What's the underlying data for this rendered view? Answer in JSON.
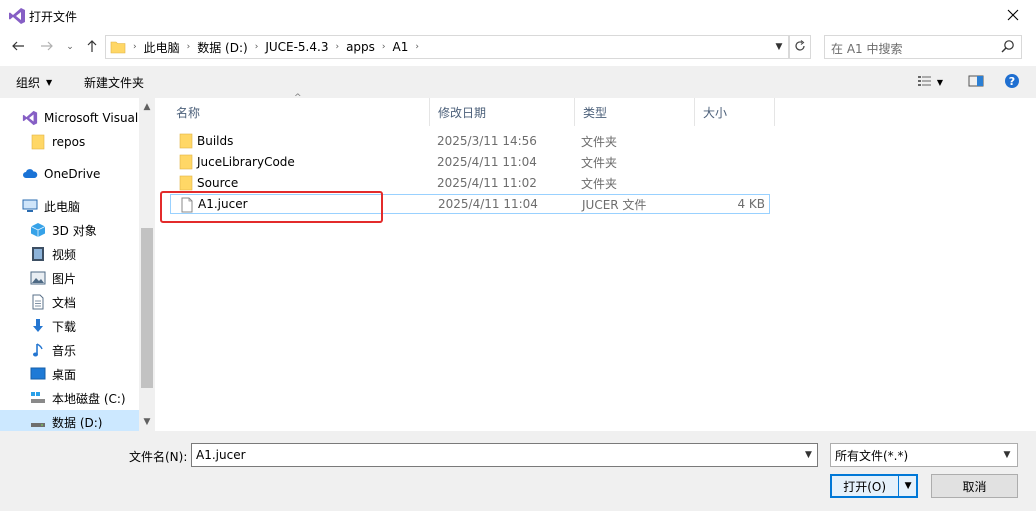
{
  "window": {
    "title": "打开文件",
    "app_icon": "visual-studio-icon",
    "close_icon": "close-icon"
  },
  "address": {
    "crumbs": [
      "此电脑",
      "数据 (D:)",
      "JUCE-5.4.3",
      "apps",
      "A1"
    ],
    "search_placeholder": "在 A1 中搜索"
  },
  "toolbar": {
    "organize_label": "组织",
    "new_folder_label": "新建文件夹"
  },
  "sidebar": {
    "items": [
      {
        "label": "Microsoft Visual",
        "icon": "visual-studio-icon"
      },
      {
        "label": "repos",
        "icon": "folder-icon"
      },
      {
        "label": "OneDrive",
        "icon": "cloud-icon"
      },
      {
        "label": "此电脑",
        "icon": "computer-icon"
      },
      {
        "label": "3D 对象",
        "icon": "cube-icon"
      },
      {
        "label": "视频",
        "icon": "video-icon"
      },
      {
        "label": "图片",
        "icon": "picture-icon"
      },
      {
        "label": "文档",
        "icon": "document-icon"
      },
      {
        "label": "下载",
        "icon": "download-icon"
      },
      {
        "label": "音乐",
        "icon": "music-icon"
      },
      {
        "label": "桌面",
        "icon": "desktop-icon"
      },
      {
        "label": "本地磁盘 (C:)",
        "icon": "drive-icon"
      },
      {
        "label": "数据 (D:)",
        "icon": "drive-icon"
      }
    ]
  },
  "columns": {
    "name": "名称",
    "modified": "修改日期",
    "type": "类型",
    "size": "大小"
  },
  "files": [
    {
      "name": "Builds",
      "modified": "2025/3/11 14:56",
      "type": "文件夹",
      "size": "",
      "icon": "folder-icon"
    },
    {
      "name": "JuceLibraryCode",
      "modified": "2025/4/11 11:04",
      "type": "文件夹",
      "size": "",
      "icon": "folder-icon"
    },
    {
      "name": "Source",
      "modified": "2025/4/11 11:02",
      "type": "文件夹",
      "size": "",
      "icon": "folder-icon"
    },
    {
      "name": "A1.jucer",
      "modified": "2025/4/11 11:04",
      "type": "JUCER 文件",
      "size": "4 KB",
      "icon": "file-icon"
    }
  ],
  "bottom": {
    "filename_label": "文件名(N):",
    "filename_value": "A1.jucer",
    "filter_value": "所有文件(*.*)",
    "open_label": "打开(O)",
    "cancel_label": "取消"
  },
  "colors": {
    "selected_bg": "#cce8ff",
    "accent": "#0078d7",
    "highlight_box": "#e32b2b",
    "folder": "#ffd766"
  }
}
